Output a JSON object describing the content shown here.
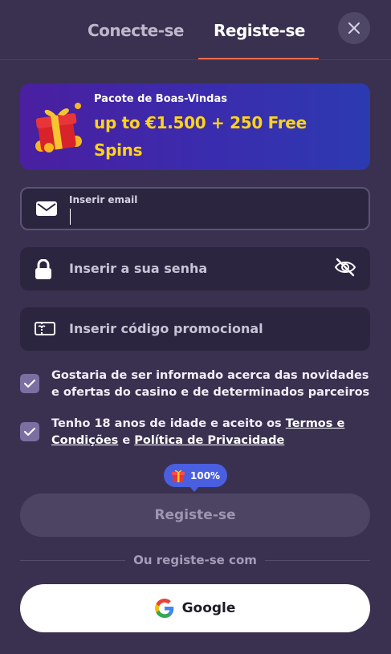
{
  "tabs": {
    "login_label": "Conecte-se",
    "register_label": "Registe-se"
  },
  "banner": {
    "subtitle": "Pacote de Boas-Vindas",
    "title": "up to €1.500 + 250 Free Spins"
  },
  "email": {
    "label": "Inserir email",
    "value": ""
  },
  "password": {
    "placeholder": "Inserir a sua senha"
  },
  "promo": {
    "placeholder": "Inserir código promocional"
  },
  "consent1": {
    "text": "Gostaria de ser informado acerca das novidades e ofertas do casino e de determinados parceiros",
    "checked": true
  },
  "consent2": {
    "prefix": "Tenho 18 anos de idade e aceito os ",
    "terms_link": "Termos e Condições",
    "middle": " e ",
    "privacy_link": "Política de Privacidade",
    "checked": true
  },
  "bonus_bubble": {
    "percent": "100%"
  },
  "submit": {
    "label": "Registe-se"
  },
  "divider": {
    "text": "Ou registe-se com"
  },
  "google": {
    "label": "Google"
  },
  "colors": {
    "background": "#3a3150",
    "accent_underline": "#e8694a",
    "banner_gold": "#ffd31a",
    "bubble_blue": "#4a5fe0"
  },
  "icons": {
    "close": "close-icon",
    "gift": "gift-icon",
    "email": "envelope-icon",
    "lock": "lock-icon",
    "eye": "eye-slash-icon",
    "promo": "ticket-icon",
    "check": "check-icon",
    "google": "google-logo-icon"
  }
}
